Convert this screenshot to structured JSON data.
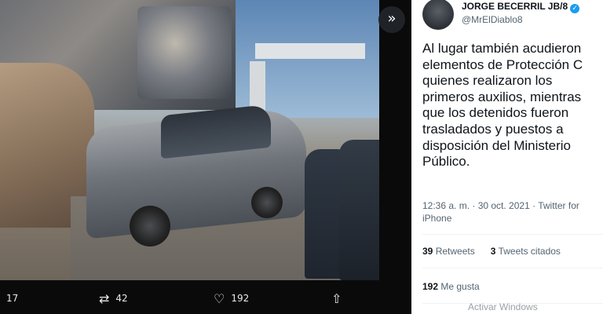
{
  "viewer": {
    "expand_icon": "»",
    "actions": {
      "reply_count": "17",
      "retweet_count": "42",
      "like_count": "192"
    }
  },
  "tweet": {
    "author_name": "JORGE BECERRIL JB/8",
    "handle": "@MrElDiablo8",
    "verified_icon": "✓",
    "text_lines": [
      "Al lugar también acudieron",
      "elementos de Protección C",
      "quienes realizaron los",
      "primeros auxilios, mientras",
      "que los detenidos fueron",
      "trasladados y puestos a",
      "disposición del Ministerio",
      "Público."
    ],
    "timestamp": "12:36 a. m. · 30 oct. 2021 · Twitter for",
    "source_line2": "iPhone",
    "retweets_count": "39",
    "retweets_label": "Retweets",
    "quotes_count": "3",
    "quotes_label": "Tweets citados",
    "likes_count": "192",
    "likes_label": "Me gusta"
  },
  "watermark": "Activar Windows",
  "colors": {
    "accent": "#1d9bf0",
    "text_primary": "#0f1419",
    "text_secondary": "#536471"
  }
}
